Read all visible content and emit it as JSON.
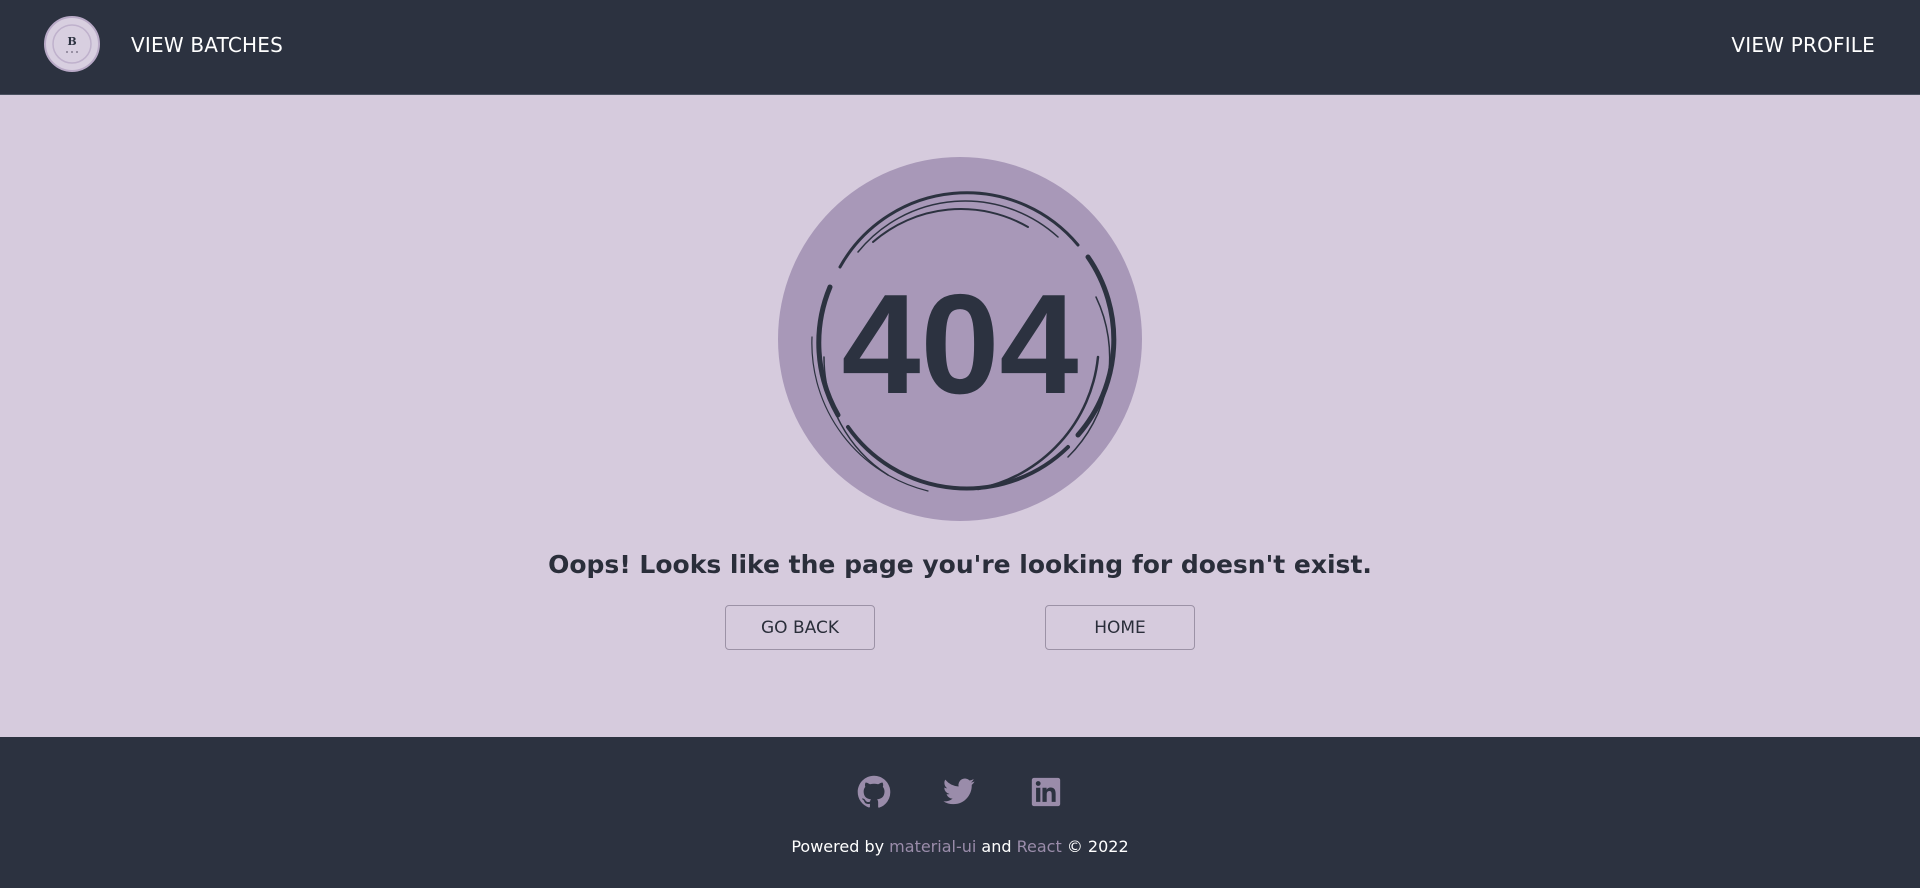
{
  "navbar": {
    "logo_letter": "B",
    "links": {
      "batches": "VIEW BATCHES",
      "profile": "VIEW PROFILE"
    }
  },
  "error": {
    "code": "404",
    "message": "Oops! Looks like the page you're looking for doesn't exist.",
    "buttons": {
      "back": "GO BACK",
      "home": "HOME"
    }
  },
  "footer": {
    "social": [
      "github-icon",
      "twitter-icon",
      "linkedin-icon"
    ],
    "powered_by": "Powered by",
    "link1": "material-ui",
    "and": "and",
    "link2": "React",
    "copyright": "© 2022"
  },
  "colors": {
    "navbar_bg": "#2c3240",
    "page_bg": "#d6cbdd",
    "circle_fill": "#a898b8",
    "text_dark": "#2a2e3a",
    "link_accent": "#9a8caa"
  }
}
